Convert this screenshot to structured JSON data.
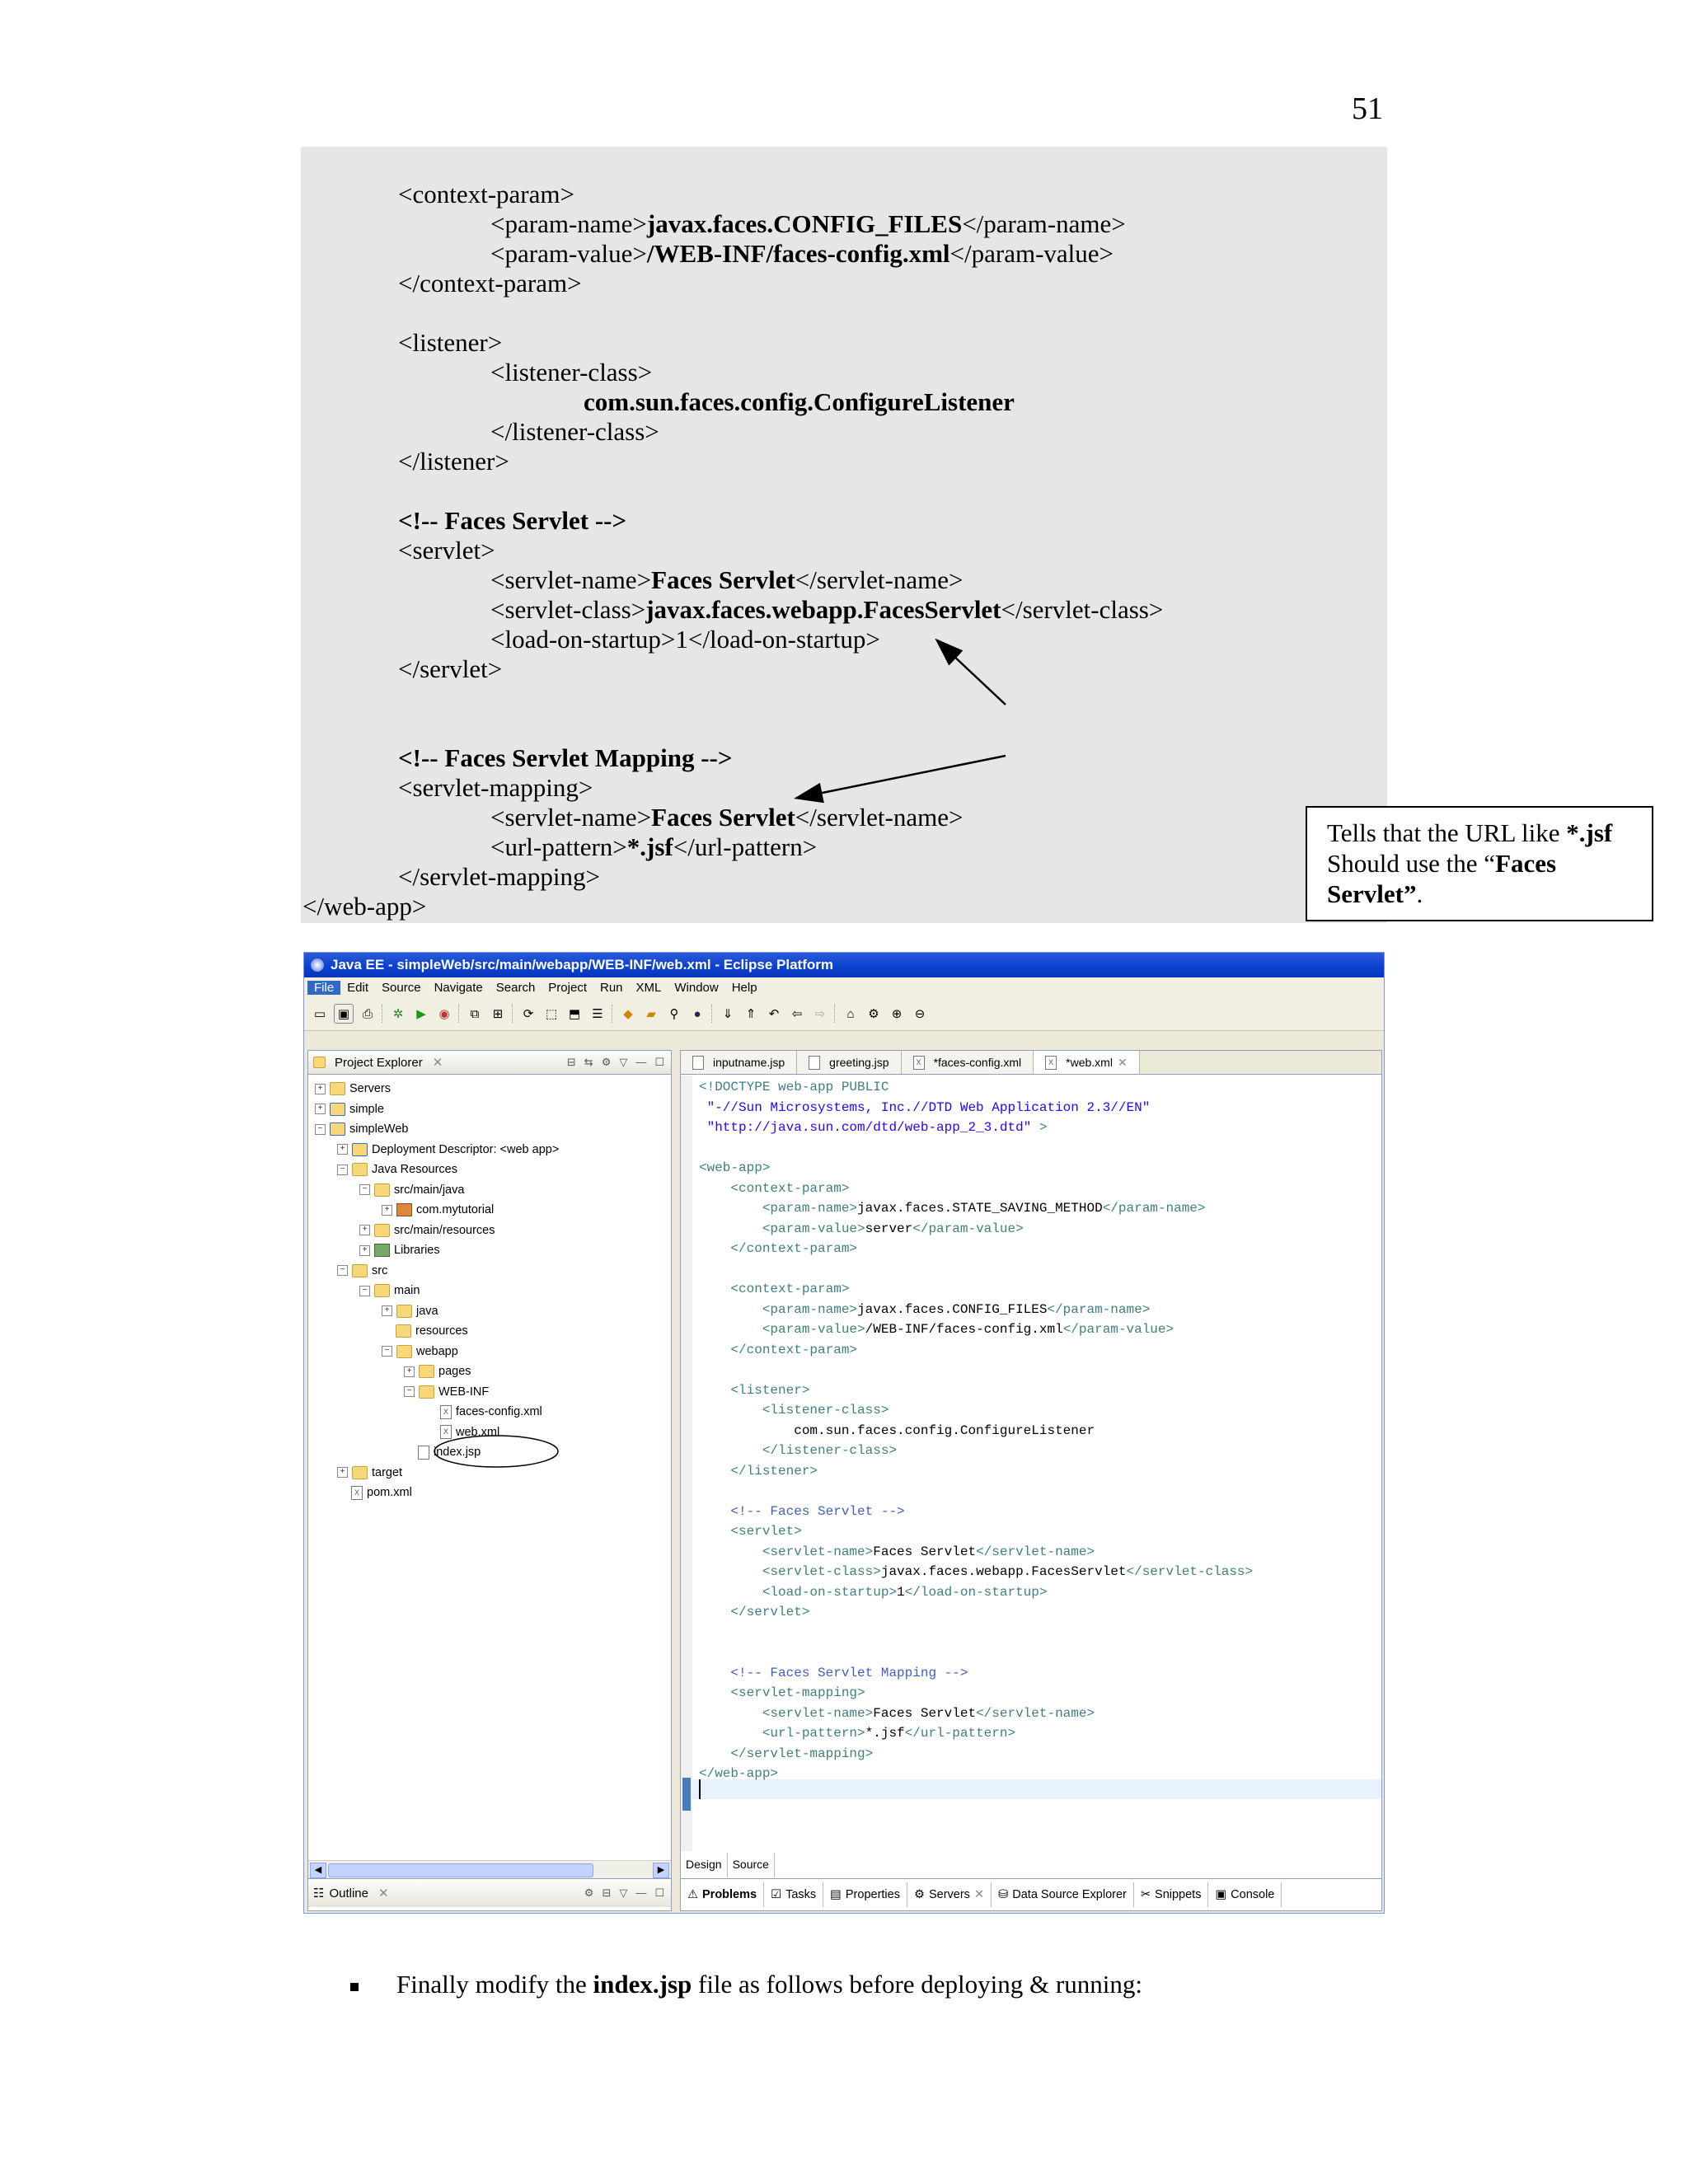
{
  "page_number": "51",
  "code_lines": [
    {
      "parts": [
        {
          "t": "<context-param>"
        }
      ]
    },
    {
      "parts": [
        {
          "t": "<param-name>"
        },
        {
          "t": "javax.faces.CONFIG_FILES",
          "b": true
        },
        {
          "t": "</param-name>"
        }
      ]
    },
    {
      "parts": [
        {
          "t": "<param-value>"
        },
        {
          "t": "/WEB-INF/faces-config.xml",
          "b": true
        },
        {
          "t": "</param-value>"
        }
      ]
    },
    {
      "parts": [
        {
          "t": "</context-param>"
        }
      ]
    },
    {
      "parts": [
        {
          "t": "<listener>"
        }
      ]
    },
    {
      "parts": [
        {
          "t": "<listener-class>"
        }
      ]
    },
    {
      "parts": [
        {
          "t": "com.sun.faces.config.ConfigureListener",
          "b": true
        }
      ]
    },
    {
      "parts": [
        {
          "t": "</listener-class>"
        }
      ]
    },
    {
      "parts": [
        {
          "t": "</listener>"
        }
      ]
    },
    {
      "parts": [
        {
          "t": "<!-- Faces Servlet -->",
          "b": true
        }
      ]
    },
    {
      "parts": [
        {
          "t": "<servlet>"
        }
      ]
    },
    {
      "parts": [
        {
          "t": "<servlet-name>"
        },
        {
          "t": "Faces Servlet",
          "b": true
        },
        {
          "t": "</servlet-name>"
        }
      ]
    },
    {
      "parts": [
        {
          "t": "<servlet-class>"
        },
        {
          "t": "javax.faces.webapp.FacesServlet",
          "b": true
        },
        {
          "t": "</servlet-class>"
        }
      ]
    },
    {
      "parts": [
        {
          "t": "<load-on-startup>1</load-on-startup>"
        }
      ]
    },
    {
      "parts": [
        {
          "t": "</servlet>"
        }
      ]
    },
    {
      "parts": [
        {
          "t": "<!-- Faces Servlet Mapping -->",
          "b": true
        }
      ]
    },
    {
      "parts": [
        {
          "t": "<servlet-mapping>"
        }
      ]
    },
    {
      "parts": [
        {
          "t": "<servlet-name>"
        },
        {
          "t": "Faces Servlet",
          "b": true
        },
        {
          "t": "</servlet-name>"
        }
      ]
    },
    {
      "parts": [
        {
          "t": "<url-pattern>"
        },
        {
          "t": "*.jsf",
          "b": true
        },
        {
          "t": "</url-pattern>"
        }
      ]
    },
    {
      "parts": [
        {
          "t": "</servlet-mapping>"
        }
      ]
    },
    {
      "parts": [
        {
          "t": "</web-app>"
        }
      ]
    }
  ],
  "callout": {
    "line1_a": "Tells that the URL like ",
    "line1_b": "*.jsf",
    "line2_a": "Should use the “",
    "line2_b": "Faces",
    "line3_b": "Servlet”",
    "line3_a": "."
  },
  "ide": {
    "title": "Java EE - simpleWeb/src/main/webapp/WEB-INF/web.xml - Eclipse Platform",
    "menu": [
      "File",
      "Edit",
      "Source",
      "Navigate",
      "Search",
      "Project",
      "Run",
      "XML",
      "Window",
      "Help"
    ],
    "project_explorer_label": "Project Explorer",
    "tree": [
      {
        "label": "Servers",
        "icon": "folder"
      },
      {
        "label": "simple",
        "icon": "proj"
      },
      {
        "label": "simpleWeb",
        "icon": "proj"
      },
      {
        "label": "Deployment Descriptor: <web app>",
        "icon": "proj"
      },
      {
        "label": "Java Resources",
        "icon": "folder"
      },
      {
        "label": "src/main/java",
        "icon": "folder"
      },
      {
        "label": "com.mytutorial",
        "icon": "pkg"
      },
      {
        "label": "src/main/resources",
        "icon": "folder"
      },
      {
        "label": "Libraries",
        "icon": "lib"
      },
      {
        "label": "src",
        "icon": "folder"
      },
      {
        "label": "main",
        "icon": "folder"
      },
      {
        "label": "java",
        "icon": "folder"
      },
      {
        "label": "resources",
        "icon": "folder"
      },
      {
        "label": "webapp",
        "icon": "folder"
      },
      {
        "label": "pages",
        "icon": "folder"
      },
      {
        "label": "WEB-INF",
        "icon": "folder"
      },
      {
        "label": "faces-config.xml",
        "icon": "xml"
      },
      {
        "label": "web.xml",
        "icon": "xml"
      },
      {
        "label": "index.jsp",
        "icon": "file"
      },
      {
        "label": "target",
        "icon": "folder"
      },
      {
        "label": "pom.xml",
        "icon": "xml"
      }
    ],
    "outline_label": "Outline",
    "editor_tabs": [
      "inputname.jsp",
      "greeting.jsp",
      "*faces-config.xml",
      "*web.xml"
    ],
    "code": [
      [
        [
          "t",
          "<!DOCTYPE web-app PUBLIC"
        ]
      ],
      [
        [
          "s",
          " \"-//Sun Microsystems, Inc.//DTD Web Application 2.3//EN\""
        ]
      ],
      [
        [
          "s",
          " \"http://java.sun.com/dtd/web-app_2_3.dtd\" "
        ],
        [
          "t",
          ">"
        ]
      ],
      [],
      [
        [
          "t",
          "<web-app>"
        ]
      ],
      [
        [
          "t",
          "    <context-param>"
        ]
      ],
      [
        [
          "t",
          "        <param-name>"
        ],
        [
          "v",
          "javax.faces.STATE_SAVING_METHOD"
        ],
        [
          "t",
          "</param-name>"
        ]
      ],
      [
        [
          "t",
          "        <param-value>"
        ],
        [
          "v",
          "server"
        ],
        [
          "t",
          "</param-value>"
        ]
      ],
      [
        [
          "t",
          "    </context-param>"
        ]
      ],
      [],
      [
        [
          "t",
          "    <context-param>"
        ]
      ],
      [
        [
          "t",
          "        <param-name>"
        ],
        [
          "v",
          "javax.faces.CONFIG_FILES"
        ],
        [
          "t",
          "</param-name>"
        ]
      ],
      [
        [
          "t",
          "        <param-value>"
        ],
        [
          "v",
          "/WEB-INF/faces-config.xml"
        ],
        [
          "t",
          "</param-value>"
        ]
      ],
      [
        [
          "t",
          "    </context-param>"
        ]
      ],
      [],
      [
        [
          "t",
          "    <listener>"
        ]
      ],
      [
        [
          "t",
          "        <listener-class>"
        ]
      ],
      [
        [
          "v",
          "            com.sun.faces.config.ConfigureListener"
        ]
      ],
      [
        [
          "t",
          "        </listener-class>"
        ]
      ],
      [
        [
          "t",
          "    </listener>"
        ]
      ],
      [],
      [
        [
          "c",
          "    <!-- Faces Servlet -->"
        ]
      ],
      [
        [
          "t",
          "    <servlet>"
        ]
      ],
      [
        [
          "t",
          "        <servlet-name>"
        ],
        [
          "v",
          "Faces Servlet"
        ],
        [
          "t",
          "</servlet-name>"
        ]
      ],
      [
        [
          "t",
          "        <servlet-class>"
        ],
        [
          "v",
          "javax.faces.webapp.FacesServlet"
        ],
        [
          "t",
          "</servlet-class>"
        ]
      ],
      [
        [
          "t",
          "        <load-on-startup>"
        ],
        [
          "v",
          "1"
        ],
        [
          "t",
          "</load-on-startup>"
        ]
      ],
      [
        [
          "t",
          "    </servlet>"
        ]
      ],
      [],
      [],
      [
        [
          "c",
          "    <!-- Faces Servlet Mapping -->"
        ]
      ],
      [
        [
          "t",
          "    <servlet-mapping>"
        ]
      ],
      [
        [
          "t",
          "        <servlet-name>"
        ],
        [
          "v",
          "Faces Servlet"
        ],
        [
          "t",
          "</servlet-name>"
        ]
      ],
      [
        [
          "t",
          "        <url-pattern>"
        ],
        [
          "v",
          "*.jsf"
        ],
        [
          "t",
          "</url-pattern>"
        ]
      ],
      [
        [
          "t",
          "    </servlet-mapping>"
        ]
      ],
      [
        [
          "t",
          "</web-app>"
        ]
      ]
    ],
    "design_tabs": [
      "Design",
      "Source"
    ],
    "bottom_tabs": [
      "Problems",
      "Tasks",
      "Properties",
      "Servers",
      "Data Source Explorer",
      "Snippets",
      "Console"
    ]
  },
  "bullet": {
    "text_a": "Finally modify the ",
    "text_b": "index.jsp",
    "text_c": " file as follows before deploying & running:"
  }
}
